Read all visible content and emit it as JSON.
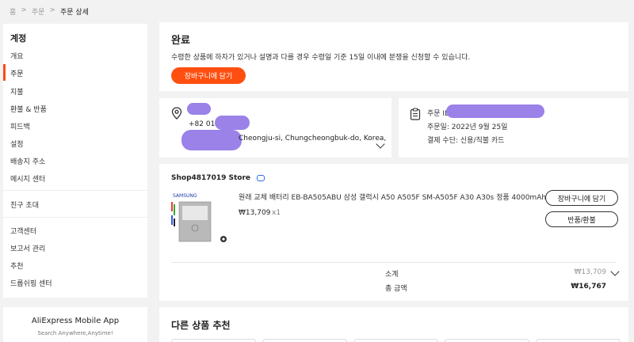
{
  "breadcrumb": {
    "home": "홈",
    "orders": "주문",
    "current": "주문 상세",
    "sep": ">"
  },
  "sidebar": {
    "title": "계정",
    "items": [
      {
        "label": "개요"
      },
      {
        "label": "주문",
        "active": true
      },
      {
        "label": "지불"
      },
      {
        "label": "환불 & 반품"
      },
      {
        "label": "피드백"
      },
      {
        "label": "설정"
      },
      {
        "label": "배송지 주소"
      },
      {
        "label": "메시지 센터"
      },
      {
        "label": "친구 초대"
      },
      {
        "label": "고객센터"
      },
      {
        "label": "보고서 관리"
      },
      {
        "label": "추천"
      },
      {
        "label": "드롭쉬핑 센터"
      }
    ]
  },
  "app_promo": {
    "title": "AliExpress Mobile App",
    "subtitle": "Search Anywhere,Anytime!"
  },
  "status": {
    "title": "완료",
    "message": "수령한 상품에 하자가 있거나 설명과 다를 경우 수령일 기준 15일 이내에 분쟁을 신청할 수 있습니다.",
    "cart_button": "장바구니에 담기"
  },
  "address": {
    "phone": "+82 010",
    "city": "Cheongju-si, Chungcheongbuk-do, Korea,"
  },
  "order_info": {
    "id_label": "주문 ID",
    "date": "주문일: 2022년 9월 25일",
    "payment": "결제 수단: 신용/직불 카드"
  },
  "store": {
    "name": "Shop4817019 Store"
  },
  "product": {
    "name": "원래 교체 배터리 EB-BA505ABU 삼성 갤럭시 A50 A505F SM-A505F A30 A30s 정품 4000mAh ...",
    "price": "₩13,709",
    "qty": "x1",
    "brand_on_image": "SAMSUNG",
    "add_cart": "장바구니에 담기",
    "return": "반품/환불"
  },
  "summary": {
    "subtotal_label": "소계",
    "subtotal_value": "₩13,709",
    "total_label": "총 금액",
    "total_value": "₩16,767"
  },
  "recommend": {
    "title": "다른 상품 추천"
  },
  "colors": {
    "accent": "#ff4f10",
    "redaction": "#9a82e8",
    "chat": "#2a6ee8"
  }
}
